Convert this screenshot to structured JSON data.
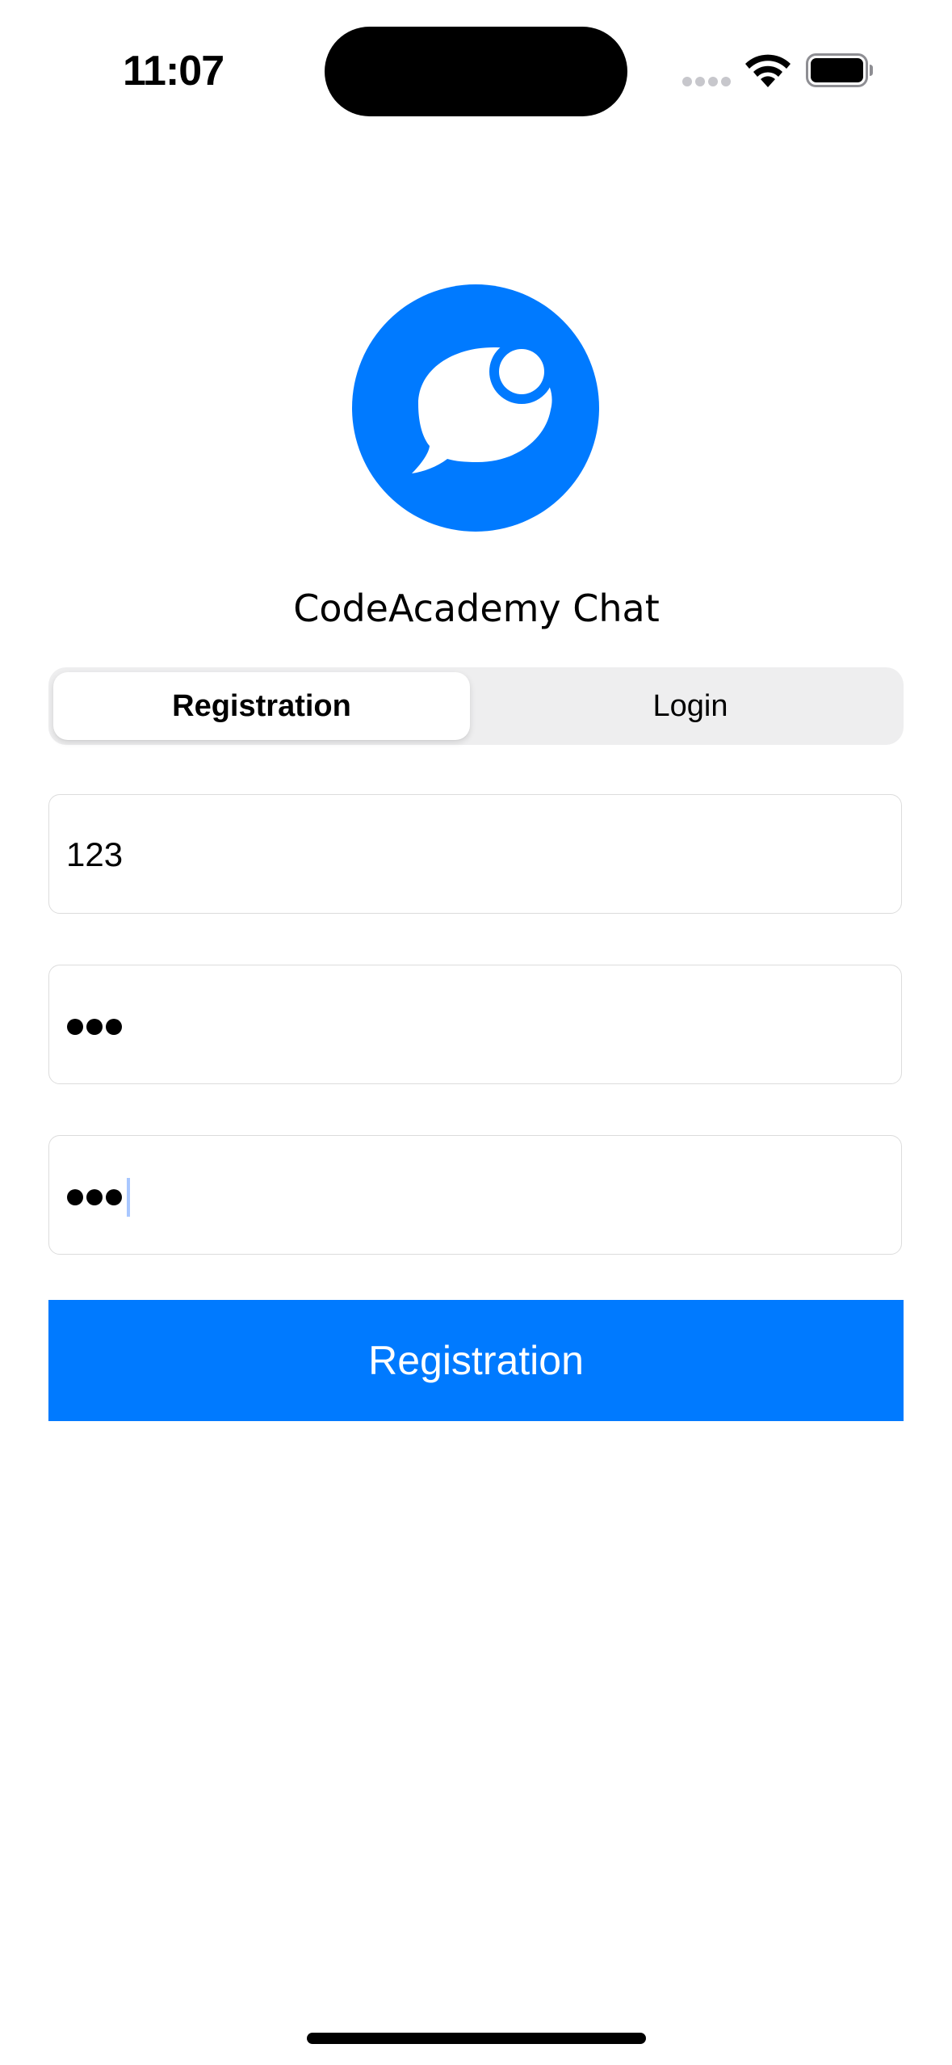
{
  "status_bar": {
    "time": "11:07"
  },
  "app": {
    "title": "CodeAcademy Chat",
    "logo_icon": "chat-bubble-icon",
    "accent_color": "#007aff"
  },
  "segmented_control": {
    "selected": "Registration",
    "segments": [
      {
        "label": "Registration"
      },
      {
        "label": "Login"
      }
    ]
  },
  "form": {
    "username_value": "123",
    "password_masked_length": 3,
    "confirm_password_masked_length": 3
  },
  "primary_button": {
    "label": "Registration"
  }
}
